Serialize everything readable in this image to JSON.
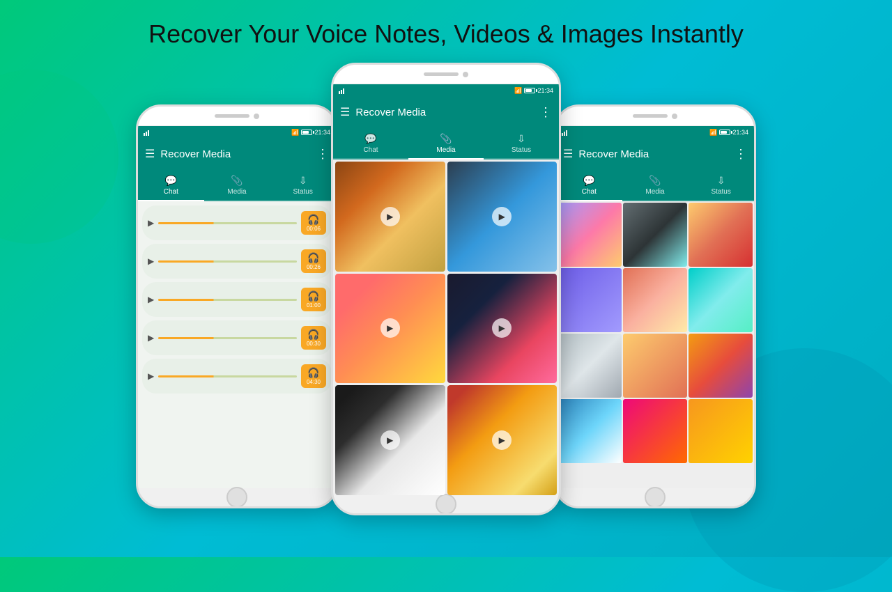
{
  "page": {
    "title": "Recover Your Voice Notes, Videos & Images Instantly"
  },
  "phones": {
    "left": {
      "app_name": "Recover Media",
      "status_time": "21:34",
      "tabs": [
        "Chat",
        "Media",
        "Status"
      ],
      "active_tab": "Chat",
      "voice_notes": [
        {
          "duration": "00:06"
        },
        {
          "duration": "00:26"
        },
        {
          "duration": "01:00"
        },
        {
          "duration": "00:30"
        },
        {
          "duration": "04:30"
        }
      ]
    },
    "center": {
      "app_name": "Recover Media",
      "status_time": "21:34",
      "tabs": [
        "Chat",
        "Media",
        "Status"
      ],
      "active_tab": "Media",
      "media_count": 6
    },
    "right": {
      "app_name": "Recover Media",
      "status_time": "21:34",
      "tabs": [
        "Chat",
        "Media",
        "Status"
      ],
      "active_tab": "Chat",
      "image_count": 12
    }
  },
  "tabs": {
    "chat_label": "Chat",
    "media_label": "Media",
    "status_label": "Status"
  }
}
